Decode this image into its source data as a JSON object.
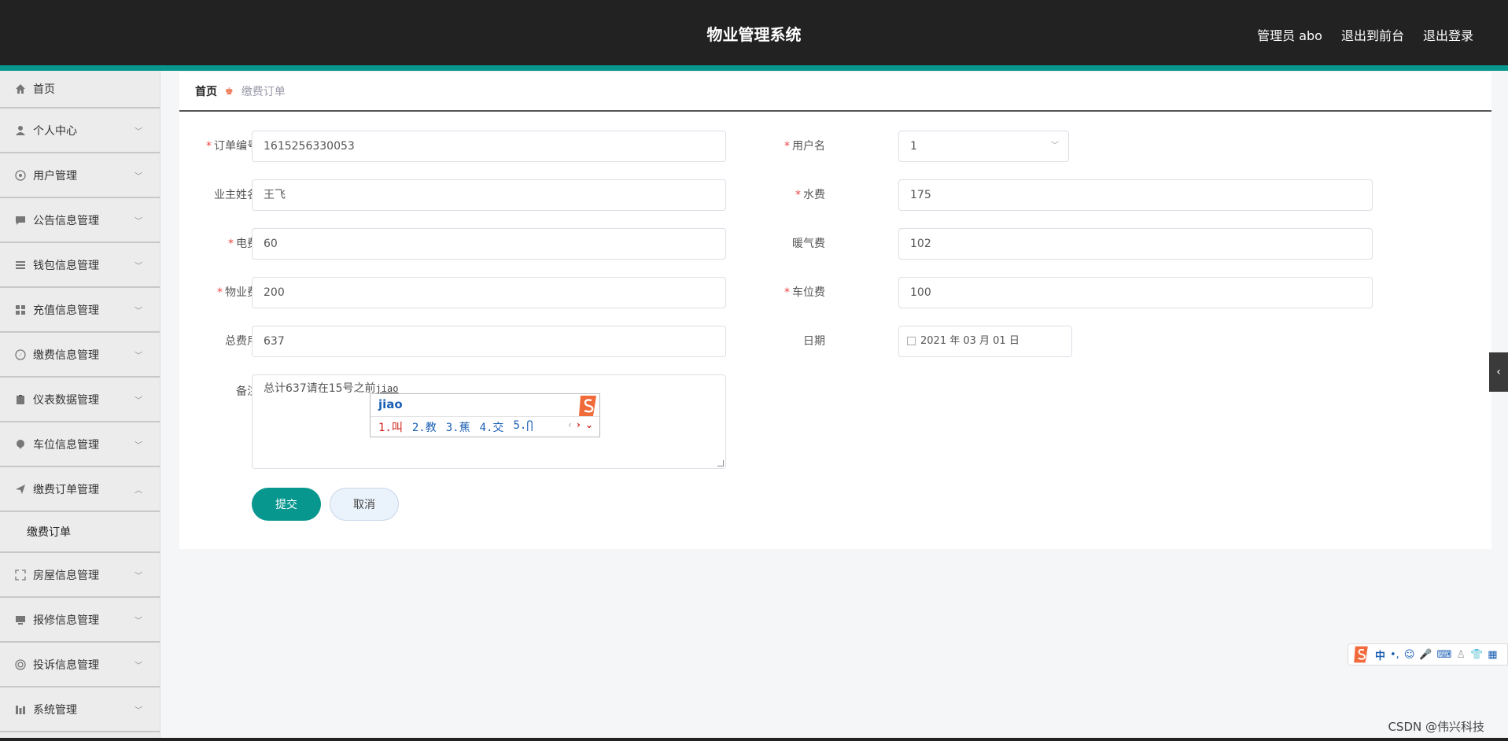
{
  "header": {
    "title": "物业管理系统",
    "user": "管理员 abo",
    "to_front": "退出到前台",
    "logout": "退出登录"
  },
  "sidebar": {
    "items": [
      {
        "label": "首页",
        "icon": "home-icon"
      },
      {
        "label": "个人中心",
        "icon": "user-icon"
      },
      {
        "label": "用户管理",
        "icon": "users-icon"
      },
      {
        "label": "公告信息管理",
        "icon": "message-icon"
      },
      {
        "label": "钱包信息管理",
        "icon": "list-icon"
      },
      {
        "label": "充值信息管理",
        "icon": "grid-icon"
      },
      {
        "label": "缴费信息管理",
        "icon": "compass-icon"
      },
      {
        "label": "仪表数据管理",
        "icon": "clipboard-icon"
      },
      {
        "label": "车位信息管理",
        "icon": "pin-icon"
      },
      {
        "label": "缴费订单管理",
        "icon": "send-icon"
      },
      {
        "label": "房屋信息管理",
        "icon": "fullscreen-icon"
      },
      {
        "label": "报修信息管理",
        "icon": "monitor-icon"
      },
      {
        "label": "投诉信息管理",
        "icon": "lifebuoy-icon"
      },
      {
        "label": "系统管理",
        "icon": "chart-icon"
      }
    ],
    "sub_active": "缴费订单"
  },
  "breadcrumb": {
    "home": "首页",
    "current": "缴费订单"
  },
  "form": {
    "order_no_label": "订单编号",
    "order_no": "1615256330053",
    "username_label": "用户名",
    "username": "1",
    "owner_name_label": "业主姓名",
    "owner_name": "王飞",
    "water_label": "水费",
    "water": "175",
    "electric_label": "电费",
    "electric": "60",
    "heating_label": "暖气费",
    "heating": "102",
    "property_label": "物业费",
    "property": "200",
    "parking_label": "车位费",
    "parking": "100",
    "total_label": "总费用",
    "total": "637",
    "date_label": "日期",
    "date": "2021 年 03 月 01 日",
    "remark_label": "备注",
    "remark": "总计637请在15号之前",
    "remark_pinyin": "jiao",
    "submit": "提交",
    "cancel": "取消"
  },
  "ime": {
    "input": "jiao",
    "candidates": [
      "1.叫",
      "2.教",
      "3.蕉",
      "4.交",
      "5.⋂"
    ],
    "bar_lang": "中"
  },
  "watermark": "CSDN @伟兴科技"
}
